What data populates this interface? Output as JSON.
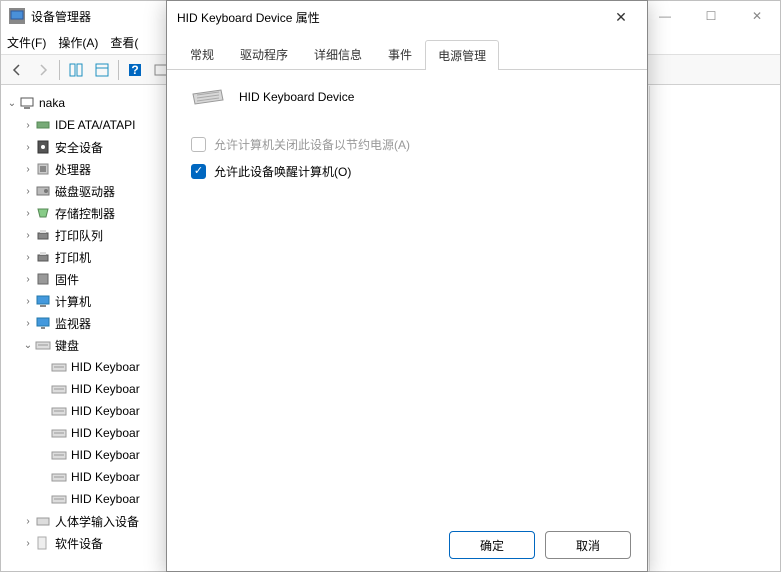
{
  "main": {
    "title": "设备管理器",
    "menu": {
      "file": "文件(F)",
      "action": "操作(A)",
      "view": "查看("
    },
    "winbtns": {
      "min": "—",
      "max": "☐",
      "close": "✕"
    }
  },
  "tree": {
    "root": "naka",
    "nodes": [
      {
        "label": "IDE ATA/ATAPI",
        "icon": "ide"
      },
      {
        "label": "安全设备",
        "icon": "security"
      },
      {
        "label": "处理器",
        "icon": "cpu"
      },
      {
        "label": "磁盘驱动器",
        "icon": "disk"
      },
      {
        "label": "存储控制器",
        "icon": "storage"
      },
      {
        "label": "打印队列",
        "icon": "printer"
      },
      {
        "label": "打印机",
        "icon": "printer"
      },
      {
        "label": "固件",
        "icon": "firmware"
      },
      {
        "label": "计算机",
        "icon": "computer"
      },
      {
        "label": "监视器",
        "icon": "monitor"
      },
      {
        "label": "键盘",
        "icon": "keyboard",
        "expanded": true,
        "children": [
          {
            "label": "HID Keyboar"
          },
          {
            "label": "HID Keyboar"
          },
          {
            "label": "HID Keyboar"
          },
          {
            "label": "HID Keyboar"
          },
          {
            "label": "HID Keyboar"
          },
          {
            "label": "HID Keyboar"
          },
          {
            "label": "HID Keyboar"
          }
        ]
      },
      {
        "label": "人体学输入设备",
        "icon": "hid"
      },
      {
        "label": "软件设备",
        "icon": "software"
      }
    ]
  },
  "dialog": {
    "title": "HID Keyboard Device 属性",
    "close": "✕",
    "tabs": {
      "general": "常规",
      "driver": "驱动程序",
      "details": "详细信息",
      "events": "事件",
      "power": "电源管理"
    },
    "device_name": "HID Keyboard Device",
    "checkbox1_label": "允许计算机关闭此设备以节约电源(A)",
    "checkbox2_label": "允许此设备唤醒计算机(O)",
    "ok": "确定",
    "cancel": "取消"
  }
}
